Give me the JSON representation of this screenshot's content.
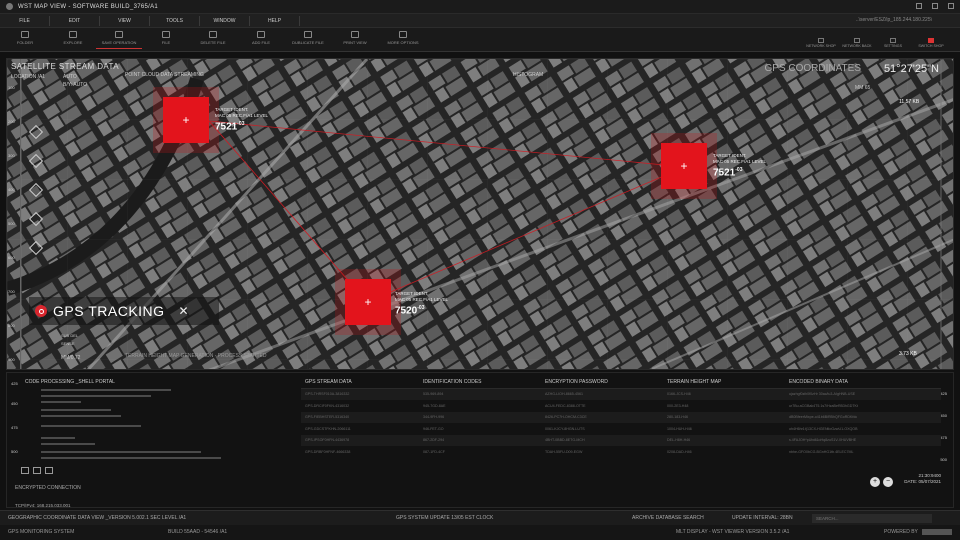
{
  "window": {
    "title": "WST MAP VIEW - SOFTWARE BUILD_3765/A1"
  },
  "menu": [
    "FILE",
    "EDIT",
    "VIEW",
    "TOOLS",
    "WINDOW",
    "HELP"
  ],
  "path": "..\\server/ESZ/ip_185.244.180.225\\",
  "toolbar": {
    "buttons": [
      "FOLDER",
      "EXPLORE",
      "SAVE OPERATION",
      "FILE",
      "DELETE FILE",
      "ADD FILE",
      "DUBLICATE FILE",
      "PRINT VIEW",
      "MORE OPTIONS"
    ],
    "right": [
      "NETWORK SHOP",
      "NETWORK BACK",
      "SETTINGS",
      "SWITCH SHOP"
    ]
  },
  "map": {
    "stream_label": "SATELLITE STREAM DATA",
    "location": "LOCATION /A1",
    "auto1": "AUTO",
    "auto2": "B/Y: AUTO",
    "pointcloud": "POINT CLOUD DATA STREAMING",
    "histogram": "HISTOGRAM",
    "gps_label": "GPS COORDINATES",
    "gps_value": "51°27'25\"N",
    "bottom_note": "TERRAIN HEIGHT MAP GENERATION - PROCESS STARTED",
    "sub_label": "SUB DEL",
    "sub_label2": "SENSE",
    "mm": "MM/0.72",
    "right_mm": "MM 65",
    "right_val": "11.57 KB",
    "right_val2": "3.73 KB",
    "gps_tracking": "GPS TRACKING",
    "targets": [
      {
        "ident": "TARGET IDENT.",
        "mac": "MAC 05 REC.F/A1 LEVEL",
        "num": "7521",
        "sup": "-03"
      },
      {
        "ident": "TARGET IDENT.",
        "mac": "MAC 05 REC.F/A1 LEVEL",
        "num": "7521",
        "sup": "-03"
      },
      {
        "ident": "TARGET IDENT.",
        "mac": "MAC 05 REC.F/A1 LEVEL",
        "num": "7520",
        "sup": "-03"
      }
    ],
    "left_ruler": [
      "100",
      "200",
      "300",
      "400",
      "500",
      "600",
      "700",
      "800",
      "900"
    ]
  },
  "bottom": {
    "code_header": "CODE PROCESSING _SHELL PORTAL",
    "encrypted": "ENCRYPTED CONNECTION",
    "ip": "TCP/IPv4: 168.215.033.001",
    "left_ruler": [
      "425",
      "450",
      "475",
      "500"
    ],
    "right_ruler": [
      "425",
      "450",
      "475",
      "500"
    ],
    "table_headers": [
      "GPS STREAM DATA",
      "IDENTIFICATION CODES",
      "ENCRYPTION PASSWORD",
      "TERRAIN HEIGHT MAP",
      "ENCODED BINARY DATA"
    ],
    "rows": [
      [
        "GPS-THRSF010A-3816332",
        "535-969-894",
        "AZHG-LIOH-8665-4561",
        "0166-JCS-H46",
        "ujazhgf0zih0f0zHr 30ac/lu3-AIgHNB-USE"
      ],
      [
        "GPS-DRCIF0FKN-4316032",
        "945-7GD-8AE",
        "ACU4-FEDC-8388-OTTE",
        "000-2E3-H48",
        "ur7Bu.aCGBak4T5.1s7/HzaBeRB3hGDTKt"
      ],
      [
        "GPS-FIEBHSTER-5316340",
        "344-9FH-996",
        "8426-PC7H-OHCM-C3CE",
        "280-183-H46",
        "dB0BfeerMixpe-o41b6BiRBhQFGoRDKfdc"
      ],
      [
        "GPS-GDCSTFKHN-2066111",
        "946-FET-GO",
        "0061-KJCY-8HGN-LUTS",
        "1004-HUH-H46",
        "oh4H6hr1t(13CX-HGENtloGzwU1-OXQOB"
      ],
      [
        "GPS-IPSOF0HFN-4436978",
        "867-2DF-294",
        "4BHT-0BBD-8ETG-MCH",
        "DEL-H8H-H46",
        "s.4FAJOH*pUbdl&oHq8zuS1V-XHUVBHE"
      ],
      [
        "GPS-DRBF0HFNF-4666338",
        "087-1FD-4CF",
        "TDAH-55FU-D09-EGW",
        "0208-DAD-H46",
        "nbhe-GFO0bCG-BGnHG1tb.4ELEC7ML"
      ]
    ],
    "time": "21:30:9400",
    "date": "DATE: 05/07/2021"
  },
  "status1": {
    "left": "GEOGRAPHIC COORDINATE DATA VIEW _VERSION 5.002.1 SEC LEVEL /A1",
    "mid": "GPS SYSTEM UPDATE 13/05 EST CLOCK",
    "archive": "ARCHIVE DATABASE SEARCH",
    "interval": "UPDATE INTERVAL: 28BN",
    "search_placeholder": "SEARCH..."
  },
  "status2": {
    "left": "GPS MONITORING SYSTEM",
    "build": "BUILD 55AAD - 54546 /A1",
    "right": "MLT DISPLAY - WST VIEWER VERSION 3.5.2 /A1",
    "powered": "POWERED BY"
  }
}
